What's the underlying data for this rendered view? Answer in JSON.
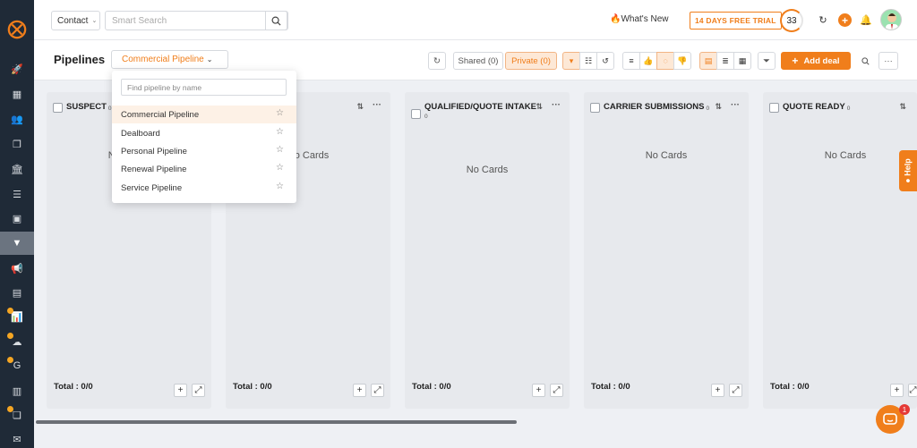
{
  "header": {
    "contact_select": "Contact",
    "search_placeholder": "Smart Search",
    "whats_new": "What's New",
    "trial_badge": "14 DAYS FREE TRIAL",
    "notification_count": "33"
  },
  "page": {
    "title": "Pipelines",
    "pipeline_selected": "Commercial Pipeline",
    "shared_label": "Shared (0)",
    "private_label": "Private (0)",
    "add_deal_label": "Add deal"
  },
  "dropdown": {
    "search_placeholder": "Find pipeline by name",
    "items": [
      {
        "label": "Commercial Pipeline"
      },
      {
        "label": "Dealboard"
      },
      {
        "label": "Personal Pipeline"
      },
      {
        "label": "Renewal Pipeline"
      },
      {
        "label": "Service Pipeline"
      }
    ]
  },
  "columns": [
    {
      "title": "SUSPECT",
      "count": "0",
      "empty_text": "No Cards",
      "total": "Total : 0/0"
    },
    {
      "title": "",
      "count": "",
      "empty_text": "No Cards",
      "total": "Total : 0/0"
    },
    {
      "title": "QUALIFIED/QUOTE INTAKE",
      "count": "0",
      "empty_text": "No Cards",
      "total": "Total : 0/0"
    },
    {
      "title": "CARRIER SUBMISSIONS",
      "count": "0",
      "empty_text": "No Cards",
      "total": "Total : 0/0"
    },
    {
      "title": "QUOTE READY",
      "count": "0",
      "empty_text": "No Cards",
      "total": "Total : 0/0"
    }
  ],
  "help_label": "Help",
  "chat_badge": "1",
  "colors": {
    "accent": "#f07e1b",
    "sidebar": "#1f2a37"
  }
}
